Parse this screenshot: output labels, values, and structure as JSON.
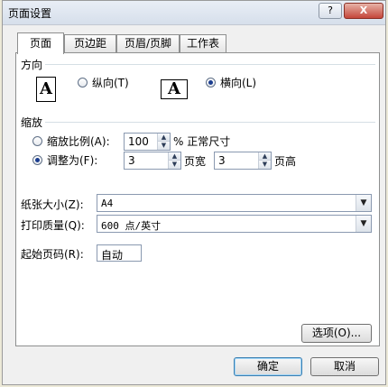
{
  "window": {
    "title": "页面设置",
    "help_label": "?",
    "close_label": "X"
  },
  "tabs": [
    "页面",
    "页边距",
    "页眉/页脚",
    "工作表"
  ],
  "orientation": {
    "group_label": "方向",
    "portrait_icon": "A",
    "portrait_label": "纵向(T)",
    "landscape_icon": "A",
    "landscape_label": "横向(L)",
    "selected": "landscape"
  },
  "scaling": {
    "group_label": "缩放",
    "adjust_to_label": "缩放比例(A):",
    "adjust_to_value": "100",
    "percent_suffix": "% 正常尺寸",
    "fit_to_label": "调整为(F):",
    "pages_wide_value": "3",
    "pages_wide_label": "页宽",
    "pages_tall_value": "3",
    "pages_tall_label": "页高",
    "selected": "fit_to"
  },
  "paper": {
    "size_label": "纸张大小(Z):",
    "size_value": "A4",
    "quality_label": "打印质量(Q):",
    "quality_value": "600 点/英寸",
    "first_page_label": "起始页码(R):",
    "first_page_value": "自动"
  },
  "buttons": {
    "options": "选项(O)...",
    "ok": "确定",
    "cancel": "取消"
  }
}
